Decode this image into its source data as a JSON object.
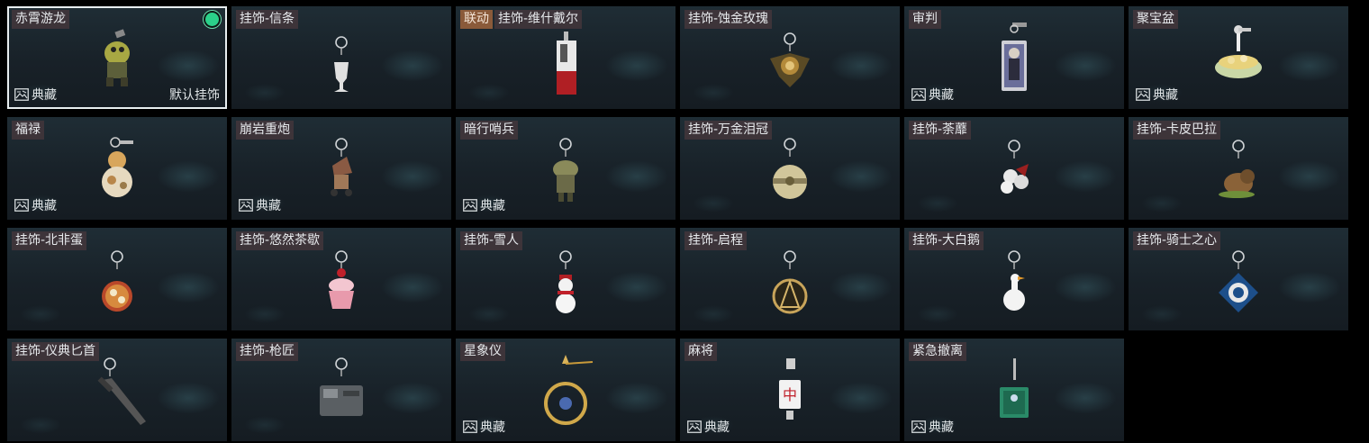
{
  "collection_label": "典藏",
  "default_label": "默认挂饰",
  "items": [
    {
      "name": "赤霄游龙",
      "selected": true,
      "default": true,
      "collection": true,
      "icon": "dragon-figure-icon"
    },
    {
      "name": "挂饰-信条",
      "icon": "creed-charm-icon"
    },
    {
      "name": "挂饰-维什戴尔",
      "collab": "联动",
      "icon": "card-charm-icon"
    },
    {
      "name": "挂饰-蚀金玫瑰",
      "icon": "gold-rose-charm-icon"
    },
    {
      "name": "审判",
      "collection": true,
      "icon": "judgement-card-icon"
    },
    {
      "name": "聚宝盆",
      "collection": true,
      "icon": "treasure-bowl-icon"
    },
    {
      "name": "福禄",
      "collection": true,
      "icon": "gourd-icon"
    },
    {
      "name": "崩岩重炮",
      "collection": true,
      "icon": "cannon-figure-icon"
    },
    {
      "name": "暗行哨兵",
      "collection": true,
      "icon": "sentinel-figure-icon"
    },
    {
      "name": "挂饰-万金泪冠",
      "icon": "crown-charm-icon"
    },
    {
      "name": "挂饰-荼蘼",
      "icon": "flower-charm-icon"
    },
    {
      "name": "挂饰-卡皮巴拉",
      "icon": "capybara-charm-icon"
    },
    {
      "name": "挂饰-北非蛋",
      "icon": "shakshuka-charm-icon"
    },
    {
      "name": "挂饰-悠然茶歇",
      "icon": "cupcake-charm-icon"
    },
    {
      "name": "挂饰-雪人",
      "icon": "snowman-charm-icon"
    },
    {
      "name": "挂饰-启程",
      "icon": "compass-charm-icon"
    },
    {
      "name": "挂饰-大白鹅",
      "icon": "goose-charm-icon"
    },
    {
      "name": "挂饰-骑士之心",
      "icon": "knight-heart-charm-icon"
    },
    {
      "name": "挂饰-仪典匕首",
      "icon": "dagger-charm-icon"
    },
    {
      "name": "挂饰-枪匠",
      "icon": "gunsmith-charm-icon"
    },
    {
      "name": "星象仪",
      "collection": true,
      "icon": "astrolabe-icon"
    },
    {
      "name": "麻将",
      "collection": true,
      "icon": "mahjong-tile-icon"
    },
    {
      "name": "紧急撤离",
      "collection": true,
      "icon": "evac-sign-icon"
    }
  ]
}
